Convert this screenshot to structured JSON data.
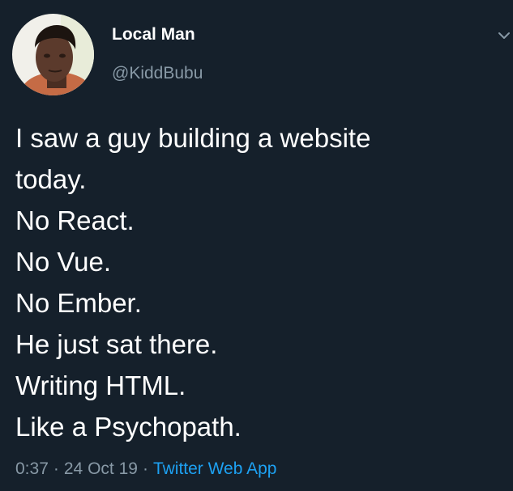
{
  "author": {
    "display_name": "Local Man",
    "handle": "@KiddBubu"
  },
  "tweet": {
    "lines": [
      "I saw a guy building a website",
      "today.",
      "No React.",
      "No Vue.",
      "No Ember.",
      "He just sat there.",
      "Writing HTML.",
      "Like a Psychopath."
    ]
  },
  "meta": {
    "time": "0:37",
    "separator": "·",
    "date": "24 Oct 19",
    "source": "Twitter Web App"
  },
  "colors": {
    "background": "#15202b",
    "text": "#ffffff",
    "secondary": "#8899a6",
    "link": "#1da1f2"
  },
  "icons": {
    "caret": "chevron-down-icon",
    "avatar": "avatar"
  }
}
